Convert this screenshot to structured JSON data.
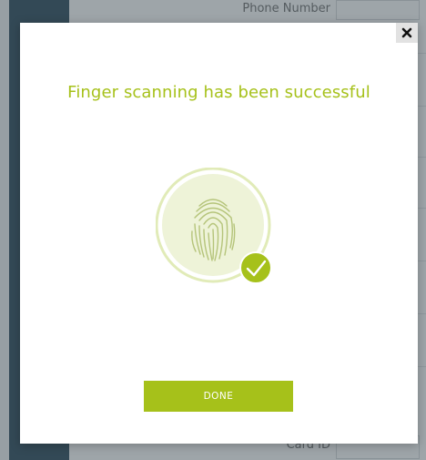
{
  "background_form": {
    "fields": [
      {
        "label": "Phone Number"
      },
      {
        "label": "Card ID"
      }
    ]
  },
  "modal": {
    "close_label": "×",
    "title": "Finger scanning has been successful",
    "status_icon": "checkmark-icon",
    "fingerprint_icon": "fingerprint-icon",
    "done_label": "DONE"
  },
  "colors": {
    "accent": "#a6c11a",
    "scan_circle_fill": "#eef3d8",
    "scan_ring": "#e1ebb8",
    "sidebar": "#3d5868"
  }
}
